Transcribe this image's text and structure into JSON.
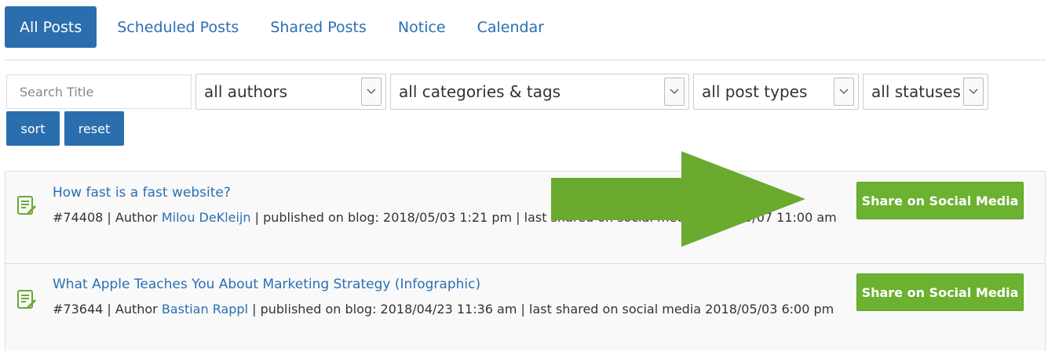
{
  "tabs": [
    {
      "label": "All Posts",
      "active": true
    },
    {
      "label": "Scheduled Posts"
    },
    {
      "label": "Shared Posts"
    },
    {
      "label": "Notice"
    },
    {
      "label": "Calendar"
    }
  ],
  "filters": {
    "search_placeholder": "Search Title",
    "authors": "all authors",
    "categories": "all categories & tags",
    "post_types": "all post types",
    "statuses": "all statuses",
    "sort_label": "sort",
    "reset_label": "reset"
  },
  "posts": [
    {
      "title": "How fast is a fast website?",
      "meta_prefix": "#74408 | Author ",
      "author": "Milou DeKleijn",
      "meta_suffix": " | published on blog: 2018/05/03 1:21 pm | last shared on social media 2018/05/07 11:00 am",
      "share_label": "Share on Social Media"
    },
    {
      "title": "What Apple Teaches You About Marketing Strategy (Infographic)",
      "meta_prefix": "#73644 | Author ",
      "author": "Bastian Rappl",
      "meta_suffix": " | published on blog: 2018/04/23 11:36 am | last shared on social media 2018/05/03 6:00 pm",
      "share_label": "Share on Social Media"
    }
  ],
  "colors": {
    "tab_active": "#2b6ead",
    "link": "#2a6fb3",
    "share_button": "#6cb12f",
    "arrow": "#6aaa2e"
  },
  "icons": {
    "post": "document-edit-icon",
    "dropdown": "chevron-down-icon",
    "annotation": "right-arrow-icon"
  }
}
